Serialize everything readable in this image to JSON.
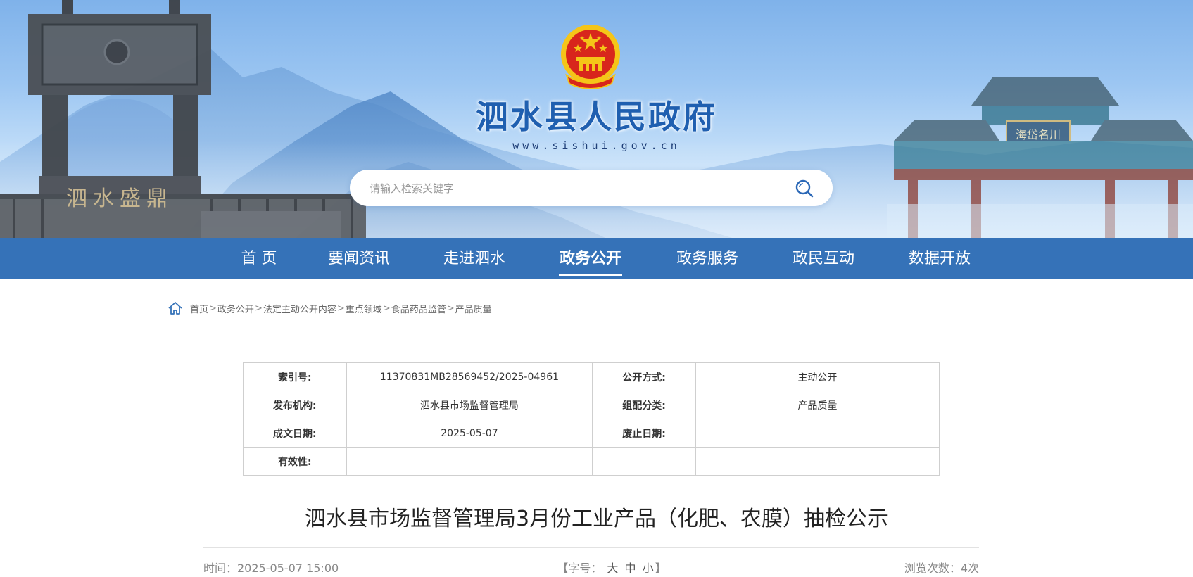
{
  "header": {
    "site_title": "泗水县人民政府",
    "site_url": "www.sishui.gov.cn",
    "monument_left_text": "泗水盛鼎",
    "gate_plaque_text": "海岱名川"
  },
  "search": {
    "placeholder": "请输入检索关键字",
    "icon": "search-icon"
  },
  "nav": {
    "items": [
      {
        "label": "首 页"
      },
      {
        "label": "要闻资讯"
      },
      {
        "label": "走进泗水"
      },
      {
        "label": "政务公开",
        "active": true
      },
      {
        "label": "政务服务"
      },
      {
        "label": "政民互动"
      },
      {
        "label": "数据开放"
      }
    ]
  },
  "breadcrumb": {
    "icon": "home-icon",
    "separator": ">",
    "items": [
      "首页",
      "政务公开",
      "法定主动公开内容",
      "重点领域",
      "食品药品监管",
      "产品质量"
    ]
  },
  "meta": {
    "index_no_label": "索引号:",
    "index_no": "11370831MB28569452/2025-04961",
    "disclosure_label": "公开方式:",
    "disclosure": "主动公开",
    "publisher_label": "发布机构:",
    "publisher": "泗水县市场监督管理局",
    "category_label": "组配分类:",
    "category": "产品质量",
    "created_label": "成文日期:",
    "created": "2025-05-07",
    "expiry_label": "废止日期:",
    "expiry": "",
    "validity_label": "有效性:",
    "validity": ""
  },
  "article": {
    "title": "泗水县市场监督管理局3月份工业产品（化肥、农膜）抽检公示",
    "time": "时间：2025-05-07 15:00",
    "font_size_open": "【字号：",
    "size_large": "大",
    "size_medium": "中",
    "size_small": "小",
    "font_size_close": "】",
    "views": "浏览次数：4次"
  },
  "colors": {
    "nav_bg": "#3572b8",
    "title_blue": "#1f5fb0",
    "emblem_red": "#d8261c",
    "emblem_gold": "#f5c518"
  }
}
